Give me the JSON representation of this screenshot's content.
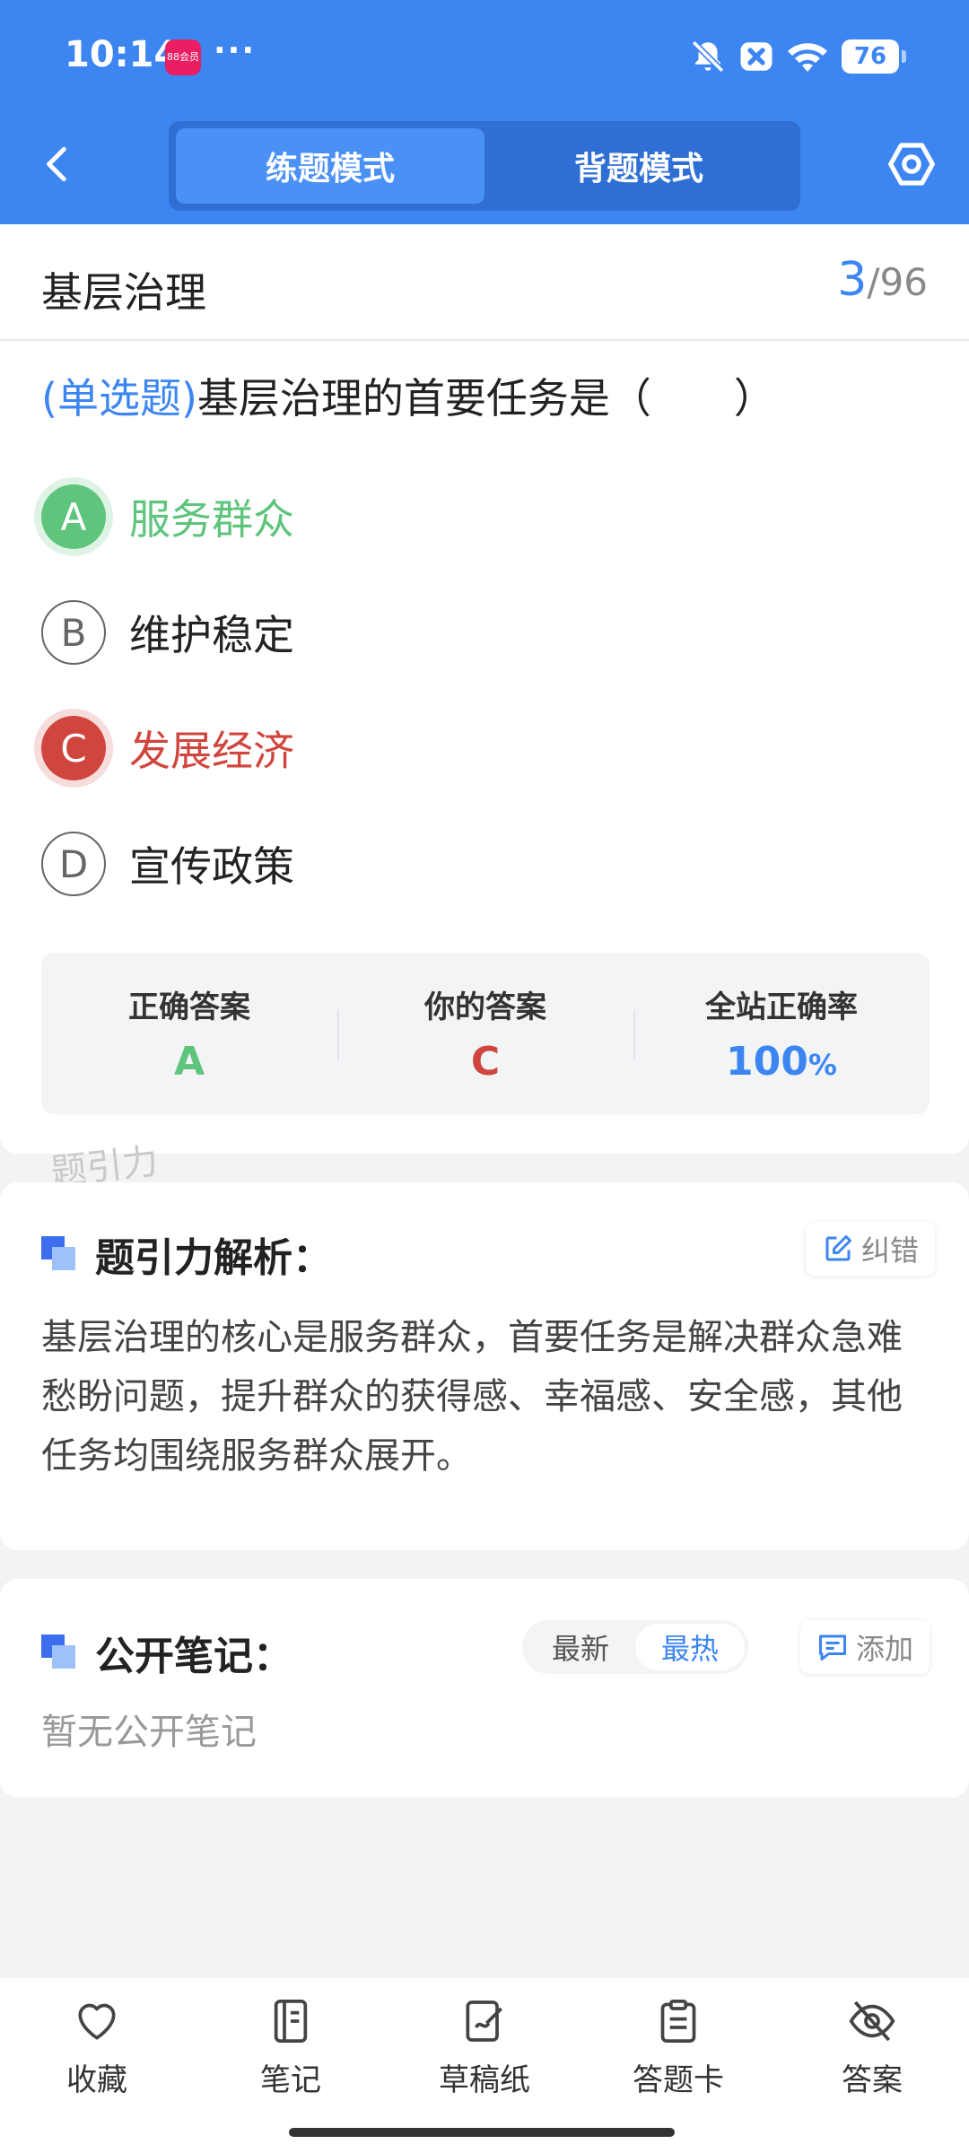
{
  "status_bar": {
    "time": "10:14",
    "app_badge": "88会员",
    "dots": "···",
    "battery": "76",
    "icons": [
      "bell-off-icon",
      "close-box-icon",
      "wifi-icon",
      "battery-icon"
    ]
  },
  "header": {
    "tabs": [
      {
        "label": "练题模式",
        "active": true
      },
      {
        "label": "背题模式",
        "active": false
      }
    ],
    "back_icon": "chevron-left-icon",
    "settings_icon": "hexagon-gear-icon"
  },
  "question": {
    "subject": "基层治理",
    "current": "3",
    "separator": "/",
    "total": "96",
    "type": "(单选题)",
    "text": "基层治理的首要任务是（　　）",
    "options": [
      {
        "letter": "A",
        "text": "服务群众",
        "state": "correct"
      },
      {
        "letter": "B",
        "text": "维护稳定",
        "state": "normal"
      },
      {
        "letter": "C",
        "text": "发展经济",
        "state": "wrong"
      },
      {
        "letter": "D",
        "text": "宣传政策",
        "state": "normal"
      }
    ]
  },
  "stats": {
    "correct_label": "正确答案",
    "correct_value": "A",
    "yours_label": "你的答案",
    "yours_value": "C",
    "rate_label": "全站正确率",
    "rate_value": "100",
    "rate_unit": "%"
  },
  "watermark": "题引力",
  "analysis": {
    "title": "题引力解析：",
    "report_label": "纠错",
    "text": "基层治理的核心是服务群众，首要任务是解决群众急难愁盼问题，提升群众的获得感、幸福感、安全感，其他任务均围绕服务群众展开。"
  },
  "notes": {
    "title": "公开笔记：",
    "sort_latest": "最新",
    "sort_hot": "最热",
    "add_label": "添加",
    "empty": "暂无公开笔记"
  },
  "bottom_nav": [
    {
      "label": "收藏",
      "icon": "heart-icon"
    },
    {
      "label": "笔记",
      "icon": "notebook-icon"
    },
    {
      "label": "草稿纸",
      "icon": "draft-pen-icon"
    },
    {
      "label": "答题卡",
      "icon": "clipboard-icon"
    },
    {
      "label": "答案",
      "icon": "eye-off-icon"
    }
  ],
  "colors": {
    "primary": "#3d86f2",
    "correct": "#5fc47c",
    "wrong": "#d0463f"
  }
}
